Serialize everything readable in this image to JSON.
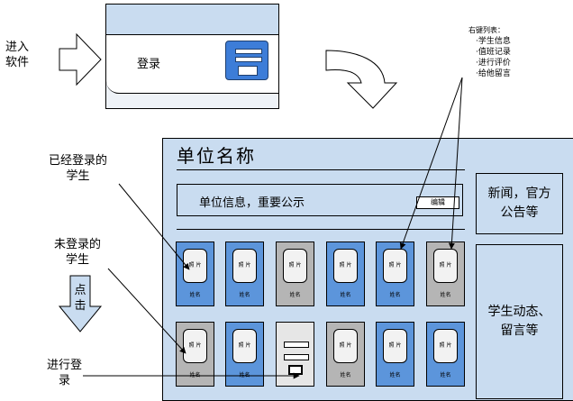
{
  "entry_label": "进入\n软件",
  "login_window": {
    "label": "登录"
  },
  "context_menu": {
    "title": "右键列表：",
    "items": [
      "·学生信息",
      "·值班记录",
      "·进行评价",
      "·给他留言"
    ]
  },
  "main_panel": {
    "title": "单位名称",
    "notice": "单位信息，重要公示",
    "edit_button": "编辑",
    "news_box": "新闻，官方\n公告等",
    "activity_box": "学生动态、\n留言等"
  },
  "annotations": {
    "logged_in": "已经登录的\n学生",
    "not_logged_in": "未登录的\n学生",
    "click": "点\n击",
    "do_login": "进行登\n录"
  },
  "card": {
    "photo": "照\n片",
    "name": "姓名"
  },
  "colors": {
    "panel": "#c9dcf0",
    "logged_in": "#5c95db",
    "not_logged_in": "#b5b5b5"
  }
}
